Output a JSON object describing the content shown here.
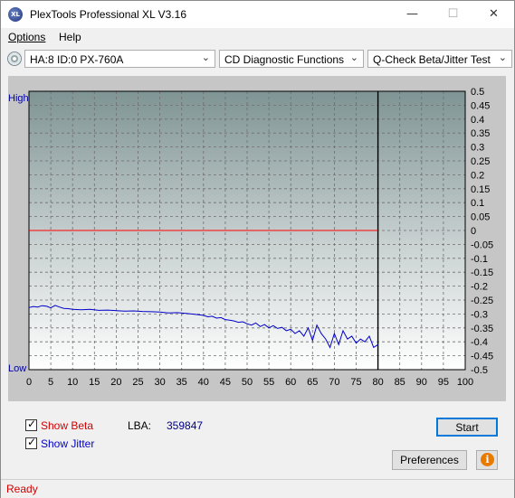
{
  "window": {
    "title": "PlexTools Professional XL V3.16",
    "app_icon_text": "XL",
    "minimize_symbol": "—",
    "maximize_symbol": "☐",
    "close_symbol": "✕"
  },
  "menu": {
    "options_label": "Options",
    "help_label": "Help"
  },
  "toolbar": {
    "drive_value": "HA:8 ID:0  PX-760A",
    "function_value": "CD Diagnostic Functions",
    "test_value": "Q-Check Beta/Jitter Test",
    "dropdown_arrow": "⌄"
  },
  "chart_data": {
    "type": "line",
    "title": "",
    "xlabel": "",
    "ylabel": "",
    "y_high_label": "High",
    "y_low_label": "Low",
    "xlim": [
      0,
      100
    ],
    "ylim": [
      -0.5,
      0.5
    ],
    "x_ticks": [
      0,
      5,
      10,
      15,
      20,
      25,
      30,
      35,
      40,
      45,
      50,
      55,
      60,
      65,
      70,
      75,
      80,
      85,
      90,
      95,
      100
    ],
    "y_ticks": [
      0.5,
      0.45,
      0.4,
      0.35,
      0.3,
      0.25,
      0.2,
      0.15,
      0.1,
      0.05,
      0,
      -0.05,
      -0.1,
      -0.15,
      -0.2,
      -0.25,
      -0.3,
      -0.35,
      -0.4,
      -0.45,
      -0.5
    ],
    "y_tick_labels": [
      "0.5",
      "0.45",
      "0.4",
      "0.35",
      "0.3",
      "0.25",
      "0.2",
      "0.15",
      "0.1",
      "0.05",
      "0",
      "-0.05",
      "-0.1",
      "-0.15",
      "-0.2",
      "-0.25",
      "-0.3",
      "-0.35",
      "-0.4",
      "-0.45",
      "-0.5"
    ],
    "grid": true,
    "data_end_x": 80,
    "series": [
      {
        "color": "#ff0000",
        "x": [
          0,
          80
        ],
        "y": [
          0,
          0
        ]
      },
      {
        "color": "#0000c8",
        "x": [
          0,
          1,
          2,
          3,
          4,
          5,
          6,
          7,
          8,
          9,
          10,
          12,
          14,
          16,
          18,
          20,
          22,
          24,
          26,
          28,
          30,
          32,
          34,
          36,
          38,
          40,
          41,
          42,
          43,
          44,
          45,
          46,
          47,
          48,
          49,
          50,
          51,
          52,
          53,
          54,
          55,
          56,
          57,
          58,
          59,
          60,
          61,
          62,
          63,
          64,
          65,
          66,
          67,
          68,
          69,
          70,
          71,
          72,
          73,
          74,
          75,
          76,
          77,
          78,
          79,
          80
        ],
        "y": [
          -0.277,
          -0.273,
          -0.275,
          -0.27,
          -0.272,
          -0.278,
          -0.269,
          -0.275,
          -0.28,
          -0.281,
          -0.283,
          -0.285,
          -0.283,
          -0.287,
          -0.286,
          -0.288,
          -0.29,
          -0.289,
          -0.291,
          -0.292,
          -0.293,
          -0.296,
          -0.295,
          -0.298,
          -0.301,
          -0.305,
          -0.31,
          -0.308,
          -0.315,
          -0.313,
          -0.32,
          -0.322,
          -0.325,
          -0.33,
          -0.328,
          -0.335,
          -0.34,
          -0.332,
          -0.345,
          -0.338,
          -0.35,
          -0.342,
          -0.352,
          -0.348,
          -0.36,
          -0.355,
          -0.37,
          -0.36,
          -0.38,
          -0.35,
          -0.395,
          -0.34,
          -0.37,
          -0.39,
          -0.42,
          -0.37,
          -0.41,
          -0.36,
          -0.39,
          -0.38,
          -0.405,
          -0.39,
          -0.4,
          -0.38,
          -0.42,
          -0.41
        ]
      }
    ]
  },
  "controls": {
    "show_beta_label": "Show Beta",
    "show_jitter_label": "Show Jitter",
    "show_beta_checked": true,
    "show_jitter_checked": true,
    "check_mark": "✓",
    "lba_label": "LBA:",
    "lba_value": "359847",
    "start_label": "Start",
    "preferences_label": "Preferences",
    "info_icon_glyph": "i",
    "beta_color": "#d00000",
    "jitter_color": "#0000c8"
  },
  "status": {
    "text": "Ready",
    "color": "#d00000"
  }
}
